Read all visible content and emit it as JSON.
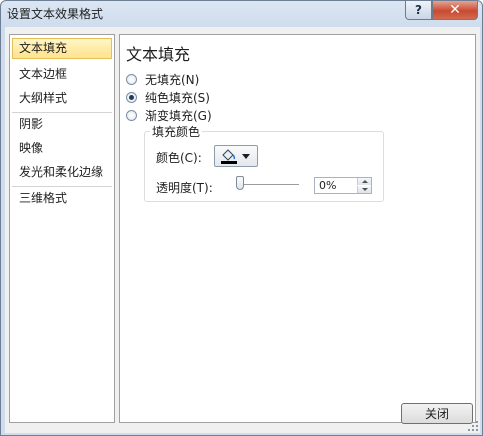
{
  "window": {
    "title": "设置文本效果格式",
    "help_label": "?",
    "close_glyph": "✕"
  },
  "sidebar": {
    "items": [
      {
        "label": "文本填充",
        "selected": true
      },
      {
        "label": "文本边框",
        "selected": false
      },
      {
        "label": "大纲样式",
        "selected": false
      },
      {
        "label": "阴影",
        "selected": false
      },
      {
        "label": "映像",
        "selected": false
      },
      {
        "label": "发光和柔化边缘",
        "selected": false
      },
      {
        "label": "三维格式",
        "selected": false
      }
    ]
  },
  "content": {
    "heading": "文本填充",
    "fill_options": [
      {
        "label": "无填充(N)",
        "checked": false
      },
      {
        "label": "纯色填充(S)",
        "checked": true
      },
      {
        "label": "渐变填充(G)",
        "checked": false
      }
    ],
    "fill_color_group": {
      "title": "填充颜色",
      "color_label": "颜色(C):",
      "color_swatch": "#000000",
      "transparency_label": "透明度(T):",
      "transparency_value": "0%",
      "transparency_fraction": 0
    }
  },
  "footer": {
    "close_label": "关闭"
  },
  "colors": {
    "selected_bg": "#ffe38d",
    "close_button_red": "#c84b31"
  }
}
